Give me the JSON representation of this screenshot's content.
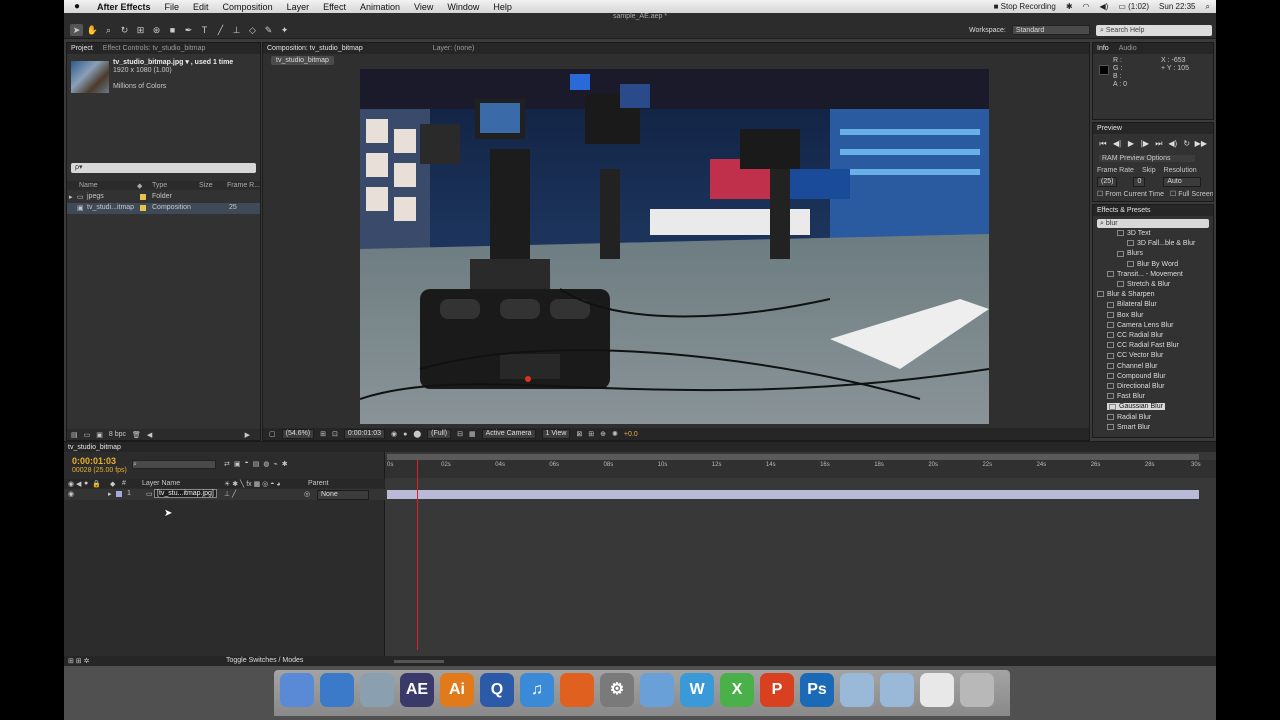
{
  "menubar": {
    "app": "After Effects",
    "items": [
      "File",
      "Edit",
      "Composition",
      "Layer",
      "Effect",
      "Animation",
      "View",
      "Window",
      "Help"
    ],
    "status": {
      "recording": "Stop Recording",
      "battery": "(1:02)",
      "clock": "Sun 22:35"
    }
  },
  "toolbar": {
    "document": "sample_AE.aep *",
    "workspace_label": "Workspace:",
    "workspace_value": "Standard",
    "search_placeholder": "Search Help"
  },
  "project": {
    "tabs": [
      "Project",
      "Effect Controls: tv_studio_bitmap"
    ],
    "info_name": "tv_studio_bitmap.jpg ▾ , used 1 time",
    "info_size": "1920 x 1080 (1.00)",
    "info_colors": "Millions of Colors",
    "search_placeholder": "ρ▾",
    "columns": [
      "Name",
      "Type",
      "Size",
      "Frame R..."
    ],
    "rows": [
      {
        "name": "jpegs",
        "type": "Folder",
        "rate": "",
        "color": "#e8c24a"
      },
      {
        "name": "tv_studi...itmap",
        "type": "Composition",
        "rate": "25",
        "color": "#e8c24a"
      }
    ],
    "bpc": "8 bpc"
  },
  "composition": {
    "tab": "Composition: tv_studio_bitmap",
    "layer_tab": "Layer: (none)",
    "label": "tv_studio_bitmap",
    "zoom": "(54.6%)",
    "timecode": "0:00:01:03",
    "resolution": "(Full)",
    "camera": "Active Camera",
    "views": "1 View",
    "exposure": "+0.0"
  },
  "info": {
    "tabs": [
      "Info",
      "Audio"
    ],
    "r": "R :",
    "g": "G :",
    "b": "B :",
    "a": "A : 0",
    "x": "X : -653",
    "y": "+ Y : 105"
  },
  "preview": {
    "title": "Preview",
    "ram_options": "RAM Preview Options",
    "frame_rate_label": "Frame Rate",
    "skip_label": "Skip",
    "resolution_label": "Resolution",
    "frame_rate": "(25)",
    "skip": "0",
    "resolution": "Auto",
    "from_current": "From Current Time",
    "full_screen": "Full Screen"
  },
  "effects": {
    "title": "Effects & Presets",
    "search": "blur",
    "items": [
      {
        "label": "3D Text",
        "indent": 2
      },
      {
        "label": "3D Fall...ble & Blur",
        "indent": 3
      },
      {
        "label": "Blurs",
        "indent": 2
      },
      {
        "label": "Blur By Word",
        "indent": 3
      },
      {
        "label": "Transit... - Movement",
        "indent": 1
      },
      {
        "label": "Stretch & Blur",
        "indent": 2
      },
      {
        "label": "Blur & Sharpen",
        "indent": 0
      },
      {
        "label": "Bilateral Blur",
        "indent": 1
      },
      {
        "label": "Box Blur",
        "indent": 1
      },
      {
        "label": "Camera Lens Blur",
        "indent": 1
      },
      {
        "label": "CC Radial Blur",
        "indent": 1
      },
      {
        "label": "CC Radial Fast Blur",
        "indent": 1
      },
      {
        "label": "CC Vector Blur",
        "indent": 1
      },
      {
        "label": "Channel Blur",
        "indent": 1
      },
      {
        "label": "Compound Blur",
        "indent": 1
      },
      {
        "label": "Directional Blur",
        "indent": 1
      },
      {
        "label": "Fast Blur",
        "indent": 1
      },
      {
        "label": "Gaussian Blur",
        "indent": 1,
        "selected": true
      },
      {
        "label": "Radial Blur",
        "indent": 1
      },
      {
        "label": "Smart Blur",
        "indent": 1
      }
    ]
  },
  "timeline": {
    "tab": "tv_studio_bitmap",
    "timecode": "0:00:01:03",
    "frames": "00028 (25.00 fps)",
    "col_layer_name": "Layer Name",
    "col_parent": "Parent",
    "col_num": "#",
    "layer_num": "1",
    "layer_name": "[tv_stu...itmap.jpg]",
    "parent_value": "None",
    "toggle": "Toggle Switches / Modes",
    "ruler": [
      "0s",
      "02s",
      "04s",
      "06s",
      "08s",
      "10s",
      "12s",
      "14s",
      "16s",
      "18s",
      "20s",
      "22s",
      "24s",
      "26s",
      "28s",
      "30s"
    ],
    "playhead_seconds": 1.12,
    "duration_seconds": 30
  },
  "dock": {
    "apps": [
      {
        "name": "finder",
        "label": "",
        "color": "#5a8ad6"
      },
      {
        "name": "safari",
        "label": "",
        "color": "#3a7ac8"
      },
      {
        "name": "preview",
        "label": "",
        "color": "#8aa0b0"
      },
      {
        "name": "after-effects",
        "label": "AE",
        "color": "#3a3a6a"
      },
      {
        "name": "illustrator",
        "label": "Ai",
        "color": "#e07a1a"
      },
      {
        "name": "quicktime",
        "label": "Q",
        "color": "#2a5aa8"
      },
      {
        "name": "itunes",
        "label": "♫",
        "color": "#3a8ad8"
      },
      {
        "name": "firefox",
        "label": "",
        "color": "#e06020"
      },
      {
        "name": "system-preferences",
        "label": "⚙",
        "color": "#7a7a7a"
      },
      {
        "name": "mail",
        "label": "",
        "color": "#6aa0d8"
      },
      {
        "name": "word",
        "label": "W",
        "color": "#3a9ad8"
      },
      {
        "name": "excel",
        "label": "X",
        "color": "#4ab04a"
      },
      {
        "name": "powerpoint",
        "label": "P",
        "color": "#d84020"
      },
      {
        "name": "photoshop",
        "label": "Ps",
        "color": "#1a6ab8"
      },
      {
        "name": "applications-folder",
        "label": "",
        "color": "#9ab8d8"
      },
      {
        "name": "documents-folder",
        "label": "",
        "color": "#9ab8d8"
      },
      {
        "name": "document",
        "label": "",
        "color": "#e8e8e8"
      },
      {
        "name": "trash",
        "label": "",
        "color": "#b8b8b8"
      }
    ]
  }
}
